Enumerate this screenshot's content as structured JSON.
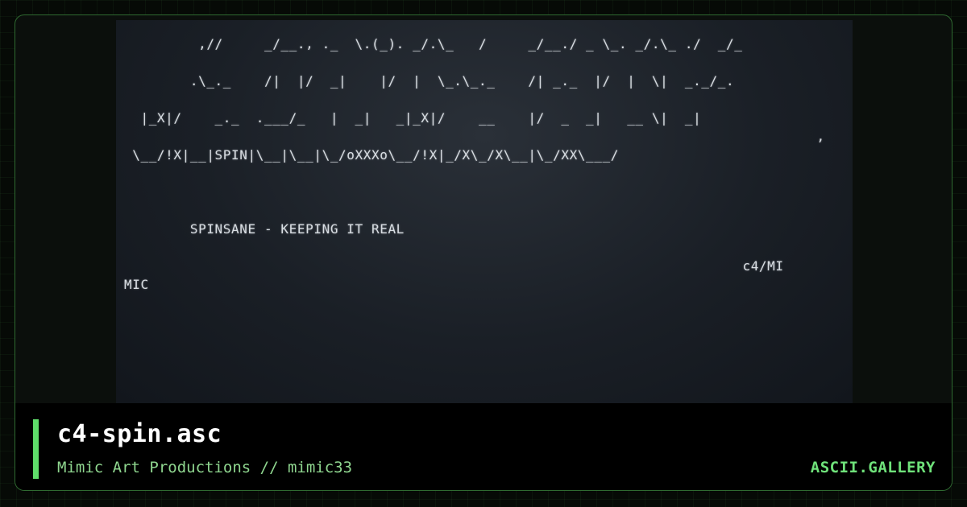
{
  "artwork": {
    "lines": "         ,//     _/__., ._  \\.(_). _/.\\_   /     _/__./ _ \\_. _/.\\_ ./  _/_\n\n        .\\_._    /|  |/  _|    |/  |  \\_.\\_._    /| _._  |/  |  \\|  _._/_.\n\n  |_X|/    _._  .___/_   |  _|   _|_X|/    __    |/  _  _|   __ \\|  _|\n                                                                                    ,\n \\__/!X|__|SPIN|\\__|\\__|\\_/oXXXo\\__/!X|_/X\\_/X\\__|\\_/XX\\___/\n\n\n\n        SPINSANE - KEEPING IT REAL\n\n                                                                           c4/MI\nMIC"
  },
  "info": {
    "title": "c4-spin.asc",
    "subtitle": "Mimic Art Productions // mimic33",
    "brand": "ASCII.GALLERY"
  },
  "colors": {
    "accent": "#5fdc6a",
    "frame_border": "#2f6a31",
    "art_text": "#d8dde2"
  }
}
